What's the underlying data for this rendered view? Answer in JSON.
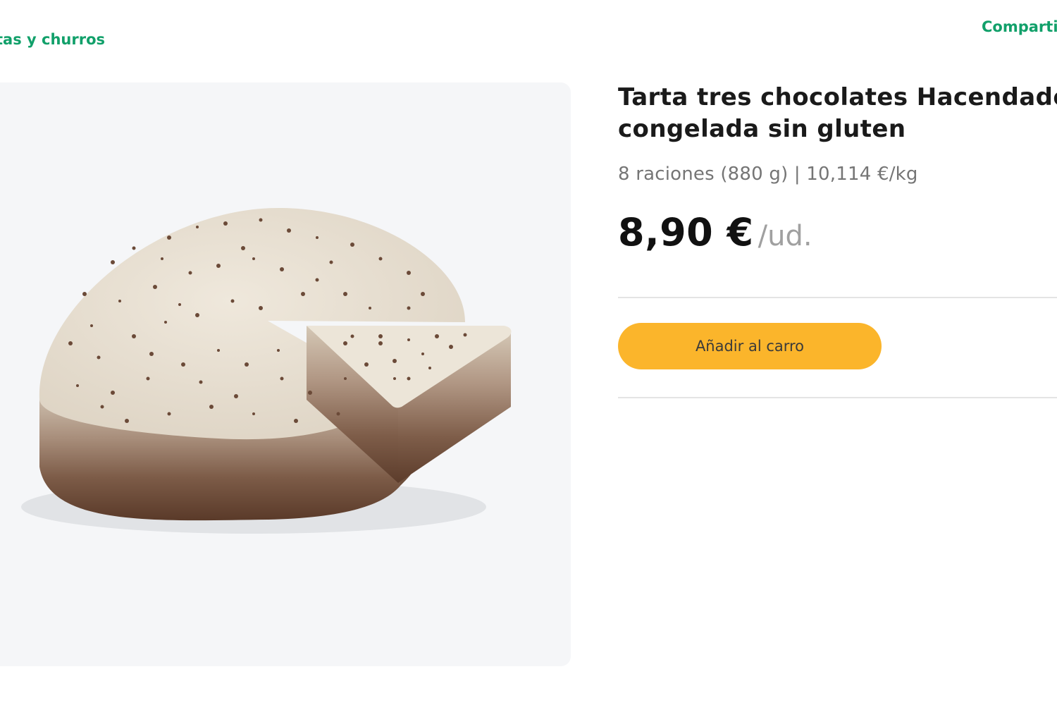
{
  "breadcrumb": {
    "label": "tas y churros"
  },
  "share": {
    "label": "Comparti"
  },
  "product": {
    "image_alt": "Tarta tres chocolates",
    "title_line1": "Tarta tres chocolates Hacendado",
    "title_line2": "congelada sin gluten",
    "format": "8 raciones (880 g) | 10,114 €/kg",
    "price": "8,90 €",
    "unit": "/ud."
  },
  "actions": {
    "add_to_cart": "Añadir al carro"
  },
  "colors": {
    "accent_green": "#11a06a",
    "button_yellow": "#fbb52b",
    "image_background": "#f5f6f8"
  }
}
